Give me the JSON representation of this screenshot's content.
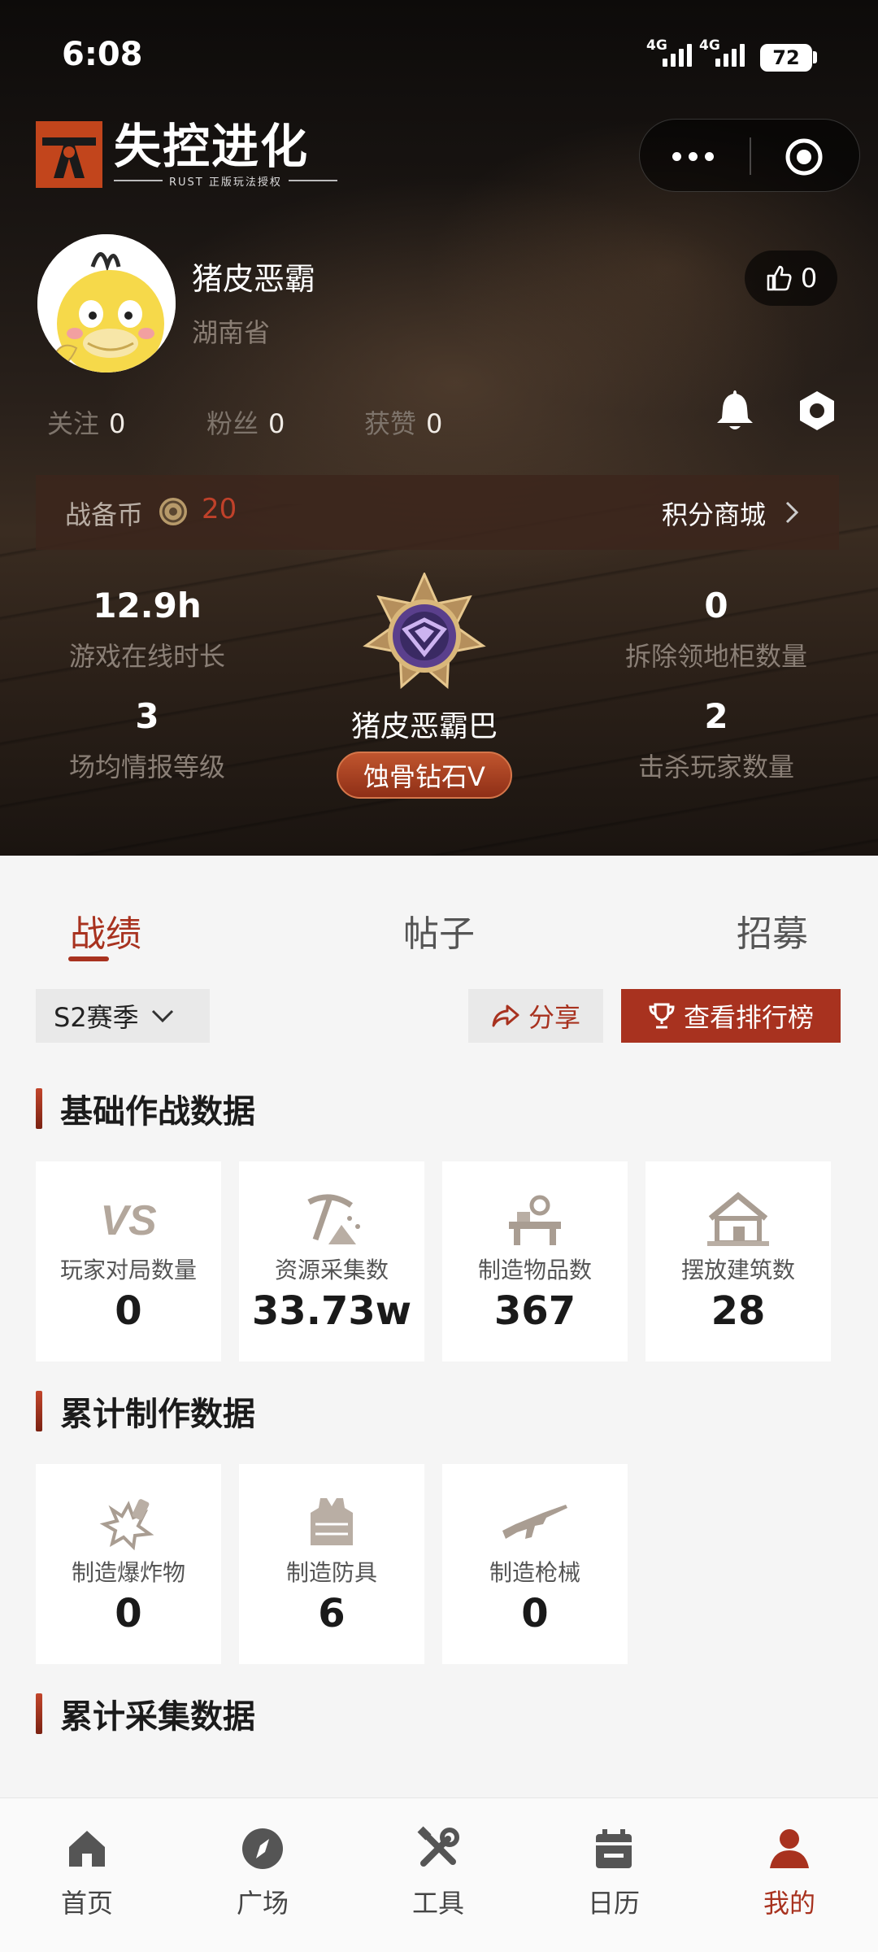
{
  "status": {
    "time": "6:08",
    "network_1": "4G",
    "network_2": "4G",
    "battery": "72"
  },
  "brand": {
    "title": "失控进化",
    "subtitle": "RUST 正版玩法授权"
  },
  "profile": {
    "username": "猪皮恶霸",
    "province": "湖南省",
    "likes": "0",
    "follow_label": "关注",
    "follow_count": "0",
    "fans_label": "粉丝",
    "fans_count": "0",
    "liked_label": "获赞",
    "liked_count": "0"
  },
  "coins": {
    "label": "战备币",
    "value": "20",
    "mall_label": "积分商城"
  },
  "metrics": {
    "online_hours": {
      "value": "12.9h",
      "label": "游戏在线时长"
    },
    "cabinets_removed": {
      "value": "0",
      "label": "拆除领地柜数量"
    },
    "intel_level": {
      "value": "3",
      "label": "场均情报等级"
    },
    "kills": {
      "value": "2",
      "label": "击杀玩家数量"
    }
  },
  "rank": {
    "player_name": "猪皮恶霸巴",
    "tier": "蚀骨钻石V"
  },
  "tabs": [
    {
      "label": "战绩",
      "active": true
    },
    {
      "label": "帖子",
      "active": false
    },
    {
      "label": "招募",
      "active": false
    }
  ],
  "toolbar": {
    "season": "S2赛季",
    "share": "分享",
    "leaderboard": "查看排行榜"
  },
  "sections": {
    "basic": {
      "title": "基础作战数据",
      "cards": [
        {
          "icon": "vs-icon",
          "label": "玩家对局数量",
          "value": "0"
        },
        {
          "icon": "pickaxe-icon",
          "label": "资源采集数",
          "value": "33.73w"
        },
        {
          "icon": "workbench-icon",
          "label": "制造物品数",
          "value": "367"
        },
        {
          "icon": "house-icon",
          "label": "摆放建筑数",
          "value": "28"
        }
      ]
    },
    "crafting": {
      "title": "累计制作数据",
      "cards": [
        {
          "icon": "explosive-icon",
          "label": "制造爆炸物",
          "value": "0"
        },
        {
          "icon": "armor-vest-icon",
          "label": "制造防具",
          "value": "6"
        },
        {
          "icon": "rifle-icon",
          "label": "制造枪械",
          "value": "0"
        }
      ]
    },
    "gathering": {
      "title": "累计采集数据"
    }
  },
  "nav": [
    {
      "icon": "home-icon",
      "label": "首页",
      "active": false
    },
    {
      "icon": "compass-icon",
      "label": "广场",
      "active": false
    },
    {
      "icon": "tools-icon",
      "label": "工具",
      "active": false
    },
    {
      "icon": "calendar-icon",
      "label": "日历",
      "active": false
    },
    {
      "icon": "profile-icon",
      "label": "我的",
      "active": true
    }
  ],
  "colors": {
    "accent": "#a8321f",
    "coin_value": "#c0412a",
    "card_icon": "#a99d92"
  }
}
